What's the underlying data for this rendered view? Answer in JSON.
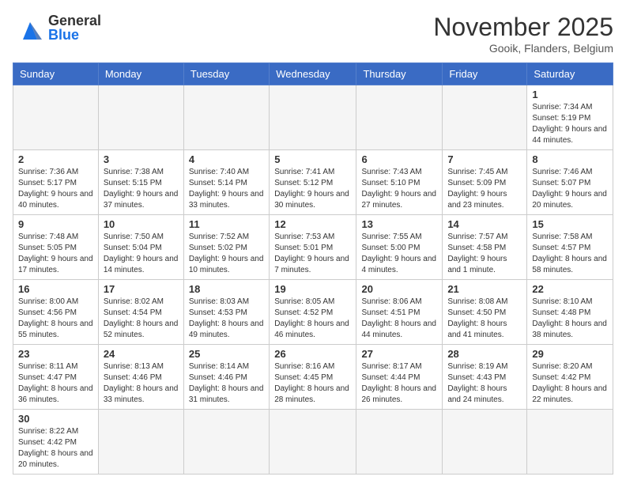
{
  "header": {
    "logo": {
      "line1": "General",
      "line2": "Blue"
    },
    "title": "November 2025",
    "subtitle": "Gooik, Flanders, Belgium"
  },
  "weekdays": [
    "Sunday",
    "Monday",
    "Tuesday",
    "Wednesday",
    "Thursday",
    "Friday",
    "Saturday"
  ],
  "weeks": [
    [
      {
        "day": "",
        "info": ""
      },
      {
        "day": "",
        "info": ""
      },
      {
        "day": "",
        "info": ""
      },
      {
        "day": "",
        "info": ""
      },
      {
        "day": "",
        "info": ""
      },
      {
        "day": "",
        "info": ""
      },
      {
        "day": "1",
        "info": "Sunrise: 7:34 AM\nSunset: 5:19 PM\nDaylight: 9 hours\nand 44 minutes."
      }
    ],
    [
      {
        "day": "2",
        "info": "Sunrise: 7:36 AM\nSunset: 5:17 PM\nDaylight: 9 hours\nand 40 minutes."
      },
      {
        "day": "3",
        "info": "Sunrise: 7:38 AM\nSunset: 5:15 PM\nDaylight: 9 hours\nand 37 minutes."
      },
      {
        "day": "4",
        "info": "Sunrise: 7:40 AM\nSunset: 5:14 PM\nDaylight: 9 hours\nand 33 minutes."
      },
      {
        "day": "5",
        "info": "Sunrise: 7:41 AM\nSunset: 5:12 PM\nDaylight: 9 hours\nand 30 minutes."
      },
      {
        "day": "6",
        "info": "Sunrise: 7:43 AM\nSunset: 5:10 PM\nDaylight: 9 hours\nand 27 minutes."
      },
      {
        "day": "7",
        "info": "Sunrise: 7:45 AM\nSunset: 5:09 PM\nDaylight: 9 hours\nand 23 minutes."
      },
      {
        "day": "8",
        "info": "Sunrise: 7:46 AM\nSunset: 5:07 PM\nDaylight: 9 hours\nand 20 minutes."
      }
    ],
    [
      {
        "day": "9",
        "info": "Sunrise: 7:48 AM\nSunset: 5:05 PM\nDaylight: 9 hours\nand 17 minutes."
      },
      {
        "day": "10",
        "info": "Sunrise: 7:50 AM\nSunset: 5:04 PM\nDaylight: 9 hours\nand 14 minutes."
      },
      {
        "day": "11",
        "info": "Sunrise: 7:52 AM\nSunset: 5:02 PM\nDaylight: 9 hours\nand 10 minutes."
      },
      {
        "day": "12",
        "info": "Sunrise: 7:53 AM\nSunset: 5:01 PM\nDaylight: 9 hours\nand 7 minutes."
      },
      {
        "day": "13",
        "info": "Sunrise: 7:55 AM\nSunset: 5:00 PM\nDaylight: 9 hours\nand 4 minutes."
      },
      {
        "day": "14",
        "info": "Sunrise: 7:57 AM\nSunset: 4:58 PM\nDaylight: 9 hours\nand 1 minute."
      },
      {
        "day": "15",
        "info": "Sunrise: 7:58 AM\nSunset: 4:57 PM\nDaylight: 8 hours\nand 58 minutes."
      }
    ],
    [
      {
        "day": "16",
        "info": "Sunrise: 8:00 AM\nSunset: 4:56 PM\nDaylight: 8 hours\nand 55 minutes."
      },
      {
        "day": "17",
        "info": "Sunrise: 8:02 AM\nSunset: 4:54 PM\nDaylight: 8 hours\nand 52 minutes."
      },
      {
        "day": "18",
        "info": "Sunrise: 8:03 AM\nSunset: 4:53 PM\nDaylight: 8 hours\nand 49 minutes."
      },
      {
        "day": "19",
        "info": "Sunrise: 8:05 AM\nSunset: 4:52 PM\nDaylight: 8 hours\nand 46 minutes."
      },
      {
        "day": "20",
        "info": "Sunrise: 8:06 AM\nSunset: 4:51 PM\nDaylight: 8 hours\nand 44 minutes."
      },
      {
        "day": "21",
        "info": "Sunrise: 8:08 AM\nSunset: 4:50 PM\nDaylight: 8 hours\nand 41 minutes."
      },
      {
        "day": "22",
        "info": "Sunrise: 8:10 AM\nSunset: 4:48 PM\nDaylight: 8 hours\nand 38 minutes."
      }
    ],
    [
      {
        "day": "23",
        "info": "Sunrise: 8:11 AM\nSunset: 4:47 PM\nDaylight: 8 hours\nand 36 minutes."
      },
      {
        "day": "24",
        "info": "Sunrise: 8:13 AM\nSunset: 4:46 PM\nDaylight: 8 hours\nand 33 minutes."
      },
      {
        "day": "25",
        "info": "Sunrise: 8:14 AM\nSunset: 4:46 PM\nDaylight: 8 hours\nand 31 minutes."
      },
      {
        "day": "26",
        "info": "Sunrise: 8:16 AM\nSunset: 4:45 PM\nDaylight: 8 hours\nand 28 minutes."
      },
      {
        "day": "27",
        "info": "Sunrise: 8:17 AM\nSunset: 4:44 PM\nDaylight: 8 hours\nand 26 minutes."
      },
      {
        "day": "28",
        "info": "Sunrise: 8:19 AM\nSunset: 4:43 PM\nDaylight: 8 hours\nand 24 minutes."
      },
      {
        "day": "29",
        "info": "Sunrise: 8:20 AM\nSunset: 4:42 PM\nDaylight: 8 hours\nand 22 minutes."
      }
    ],
    [
      {
        "day": "30",
        "info": "Sunrise: 8:22 AM\nSunset: 4:42 PM\nDaylight: 8 hours\nand 20 minutes."
      },
      {
        "day": "",
        "info": ""
      },
      {
        "day": "",
        "info": ""
      },
      {
        "day": "",
        "info": ""
      },
      {
        "day": "",
        "info": ""
      },
      {
        "day": "",
        "info": ""
      },
      {
        "day": "",
        "info": ""
      }
    ]
  ]
}
